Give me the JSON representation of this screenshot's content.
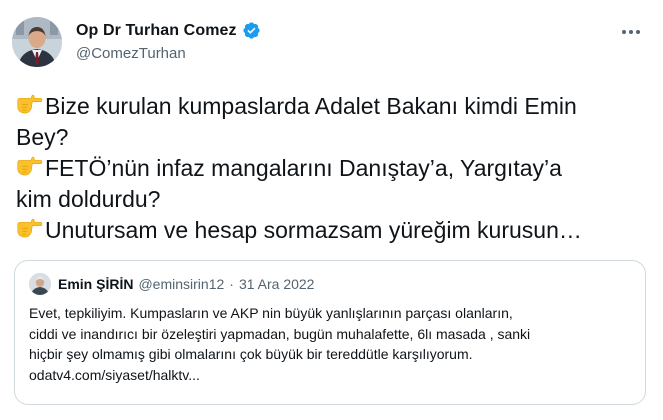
{
  "author": {
    "display_name": "Op Dr Turhan Comez",
    "handle": "@ComezTurhan",
    "verified": true
  },
  "tweet": {
    "lines": [
      "Bize kurulan kumpaslarda Adalet Bakanı kimdi Emin",
      "Bey?",
      "FETÖ’nün infaz mangalarını Danıştay’a, Yargıtay’a",
      "kim doldurdu?",
      "Unutursam ve hesap sormazsam yüreğim kurusun…"
    ]
  },
  "quoted_tweet": {
    "display_name": "Emin ŞİRİN",
    "handle": "@eminsirin12",
    "separator": "·",
    "date": "31 Ara 2022",
    "lines": [
      "Evet, tepkiliyim. Kumpasların ve AKP nin büyük yanlışlarının parçası olanların,",
      "ciddi ve inandırıcı bir özeleştiri yapmadan, bugün muhalafette, 6lı masada , sanki",
      "hiçbir şey olmamış gibi olmalarını çok büyük bir tereddütle karşılıyorum.",
      "odatv4.com/siyaset/halktv..."
    ]
  },
  "icons": {
    "verified": "verified-badge-icon",
    "more": "more-options-icon",
    "pointing": "backhand-index-pointing-right-emoji"
  },
  "colors": {
    "verified_blue": "#1d9bf0",
    "text_primary": "#0f1419",
    "text_secondary": "#536471",
    "border": "#cfd9de",
    "emoji_yellow": "#fbc02d"
  }
}
